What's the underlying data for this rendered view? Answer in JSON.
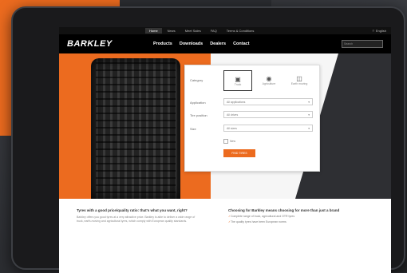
{
  "topbar": {
    "links": [
      "Home",
      "News",
      "Meet Sales",
      "FAQ",
      "Terms & Conditions"
    ],
    "language": "English"
  },
  "nav": {
    "logo_first": "B",
    "logo_rest": "ARKLEY",
    "items": [
      "Products",
      "Downloads",
      "Dealers",
      "Contact"
    ],
    "search_placeholder": "Search"
  },
  "finder": {
    "category_label": "Category",
    "categories": [
      "Truck",
      "Agriculture",
      "Earth moving"
    ],
    "application_label": "Application",
    "application_value": "All applications",
    "dimension_label": "Tire position",
    "dimension_value": "All drives",
    "size_label": "Size",
    "size_value": "All sizes",
    "checkbox_label": "New",
    "search_button": "FIND TIRES"
  },
  "info": {
    "left_title": "Tyres with a good price/quality ratio: that's what you want, right?",
    "left_text": "Barkley offers you good tyres at a very attractive price. Barkley is able to deliver a wide range of truck, earth-moving and agricultural tyres, which comply with European quality standards.",
    "right_title": "Choosing for Barkley means choosing for more than just a brand",
    "right_items": [
      "Complete range of truck, agricultural and OTR tyres",
      "The quality tyres have been European norms"
    ]
  }
}
